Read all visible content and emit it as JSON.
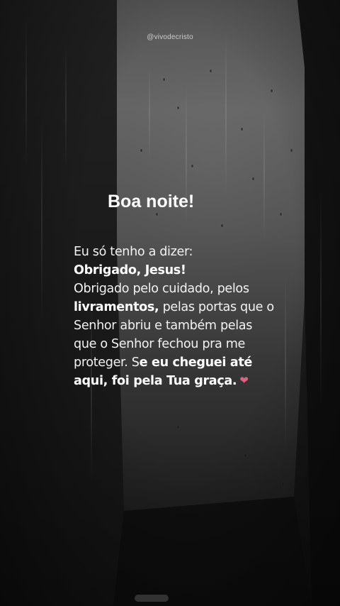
{
  "watermark": "@vivodecristo",
  "greeting": "Boa noite!",
  "message": {
    "line1": "Eu só tenho a dizer:",
    "line2_bold": "Obrigado, Jesus!",
    "line3": "Obrigado pelo cuidado, pelos",
    "line4_bold": "livramentos,",
    "line4_rest": " pelas portas que o",
    "line5": "Senhor abriu e também pelas",
    "line6": "que o Senhor fechou pra me",
    "line7_start": "proteger. S",
    "line7_bold": "e eu cheguei até",
    "line8_bold": "aqui, foi pela Tua graça.",
    "heart_icon": "anatomical-heart-icon"
  },
  "colors": {
    "text": "#ffffff",
    "heart": "#e0607e",
    "background": "#0d0d0d"
  }
}
